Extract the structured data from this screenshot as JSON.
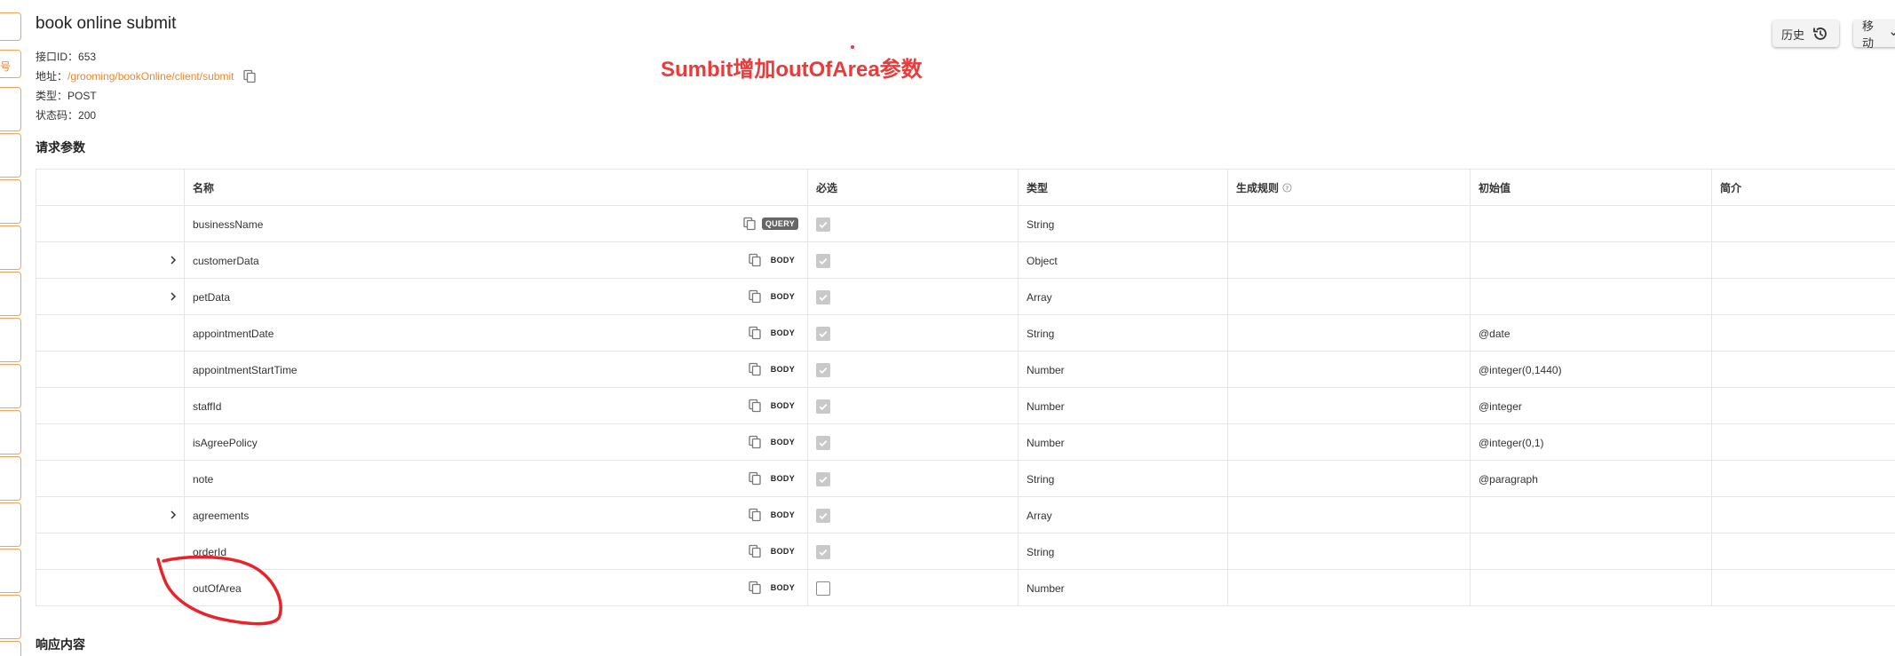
{
  "header": {
    "title": "book online submit",
    "id_label": "接口ID：",
    "id_value": "653",
    "addr_label": "地址：",
    "addr_value": "/grooming/bookOnline/client/submit",
    "type_label": "类型：",
    "type_value": "POST",
    "status_label": "状态码：",
    "status_value": "200"
  },
  "annotation": "Sumbit增加outOfArea参数",
  "toolbar": {
    "history_label": "历史",
    "move_label": "移动"
  },
  "sections": {
    "request": "请求参数",
    "response": "响应内容"
  },
  "table": {
    "headers": [
      "名称",
      "必选",
      "类型",
      "生成规则",
      "初始值",
      "简介"
    ],
    "rows": [
      {
        "name": "businessName",
        "tag": "QUERY",
        "required": true,
        "type": "String",
        "init": "",
        "expand": false
      },
      {
        "name": "customerData",
        "tag": "BODY",
        "required": true,
        "type": "Object",
        "init": "",
        "expand": true
      },
      {
        "name": "petData",
        "tag": "BODY",
        "required": true,
        "type": "Array",
        "init": "",
        "expand": true
      },
      {
        "name": "appointmentDate",
        "tag": "BODY",
        "required": true,
        "type": "String",
        "init": "@date",
        "expand": false
      },
      {
        "name": "appointmentStartTime",
        "tag": "BODY",
        "required": true,
        "type": "Number",
        "init": "@integer(0,1440)",
        "expand": false
      },
      {
        "name": "staffId",
        "tag": "BODY",
        "required": true,
        "type": "Number",
        "init": "@integer",
        "expand": false
      },
      {
        "name": "isAgreePolicy",
        "tag": "BODY",
        "required": true,
        "type": "Number",
        "init": "@integer(0,1)",
        "expand": false
      },
      {
        "name": "note",
        "tag": "BODY",
        "required": true,
        "type": "String",
        "init": "@paragraph",
        "expand": false
      },
      {
        "name": "agreements",
        "tag": "BODY",
        "required": true,
        "type": "Array",
        "init": "",
        "expand": true
      },
      {
        "name": "orderId",
        "tag": "BODY",
        "required": true,
        "type": "String",
        "init": "",
        "expand": false
      },
      {
        "name": "outOfArea",
        "tag": "BODY",
        "required": false,
        "type": "Number",
        "init": "",
        "expand": false
      }
    ]
  },
  "colors": {
    "accent": "#e8892e",
    "annotation": "#ea3a3a",
    "border": "#e6e6e6"
  }
}
